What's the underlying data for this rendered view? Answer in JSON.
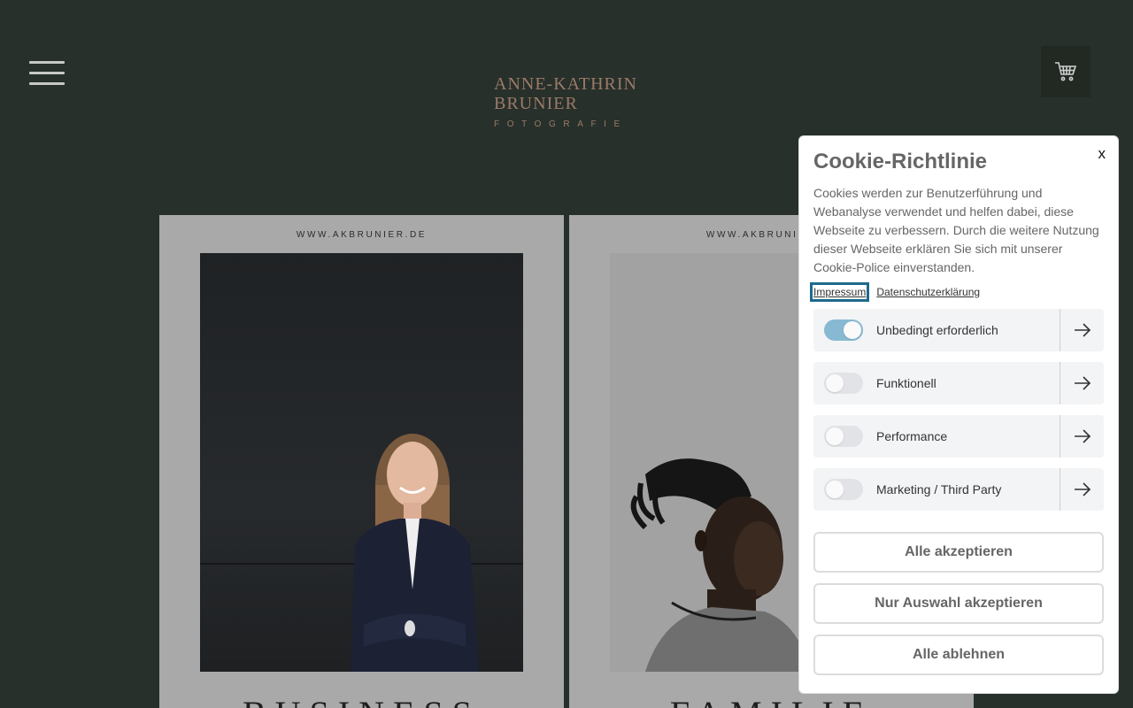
{
  "header": {
    "logo_line1": "ANNE-KATHRIN",
    "logo_line2": "BRUNIER",
    "logo_line3": "FOTOGRAFIE"
  },
  "cards": [
    {
      "url": "WWW.AKBRUNIER.DE",
      "caption": "BUSINESS"
    },
    {
      "url": "WWW.AKBRUNIER.DE",
      "caption": "FAMILIE"
    }
  ],
  "cookie": {
    "close": "x",
    "title": "Cookie-Richtlinie",
    "description": "Cookies werden zur Benutzerführung und Webanalyse verwendet und helfen dabei, diese Webseite zu verbessern. Durch die weitere Nutzung dieser Webseite erklären Sie sich mit unserer Cookie-Police einverstanden.",
    "links": [
      "Impressum",
      "Datenschutzerklärung"
    ],
    "options": [
      {
        "label": "Unbedingt erforderlich",
        "enabled": true
      },
      {
        "label": "Funktionell",
        "enabled": false
      },
      {
        "label": "Performance",
        "enabled": false
      },
      {
        "label": "Marketing / Third Party",
        "enabled": false
      }
    ],
    "buttons": {
      "accept_all": "Alle akzeptieren",
      "accept_selection": "Nur Auswahl akzeptieren",
      "reject_all": "Alle ablehnen"
    }
  },
  "colors": {
    "background": "#27302a",
    "logo": "#9b7a6a",
    "toggle_on": "#88b9d2",
    "focus_outline": "#1d6a8d"
  }
}
